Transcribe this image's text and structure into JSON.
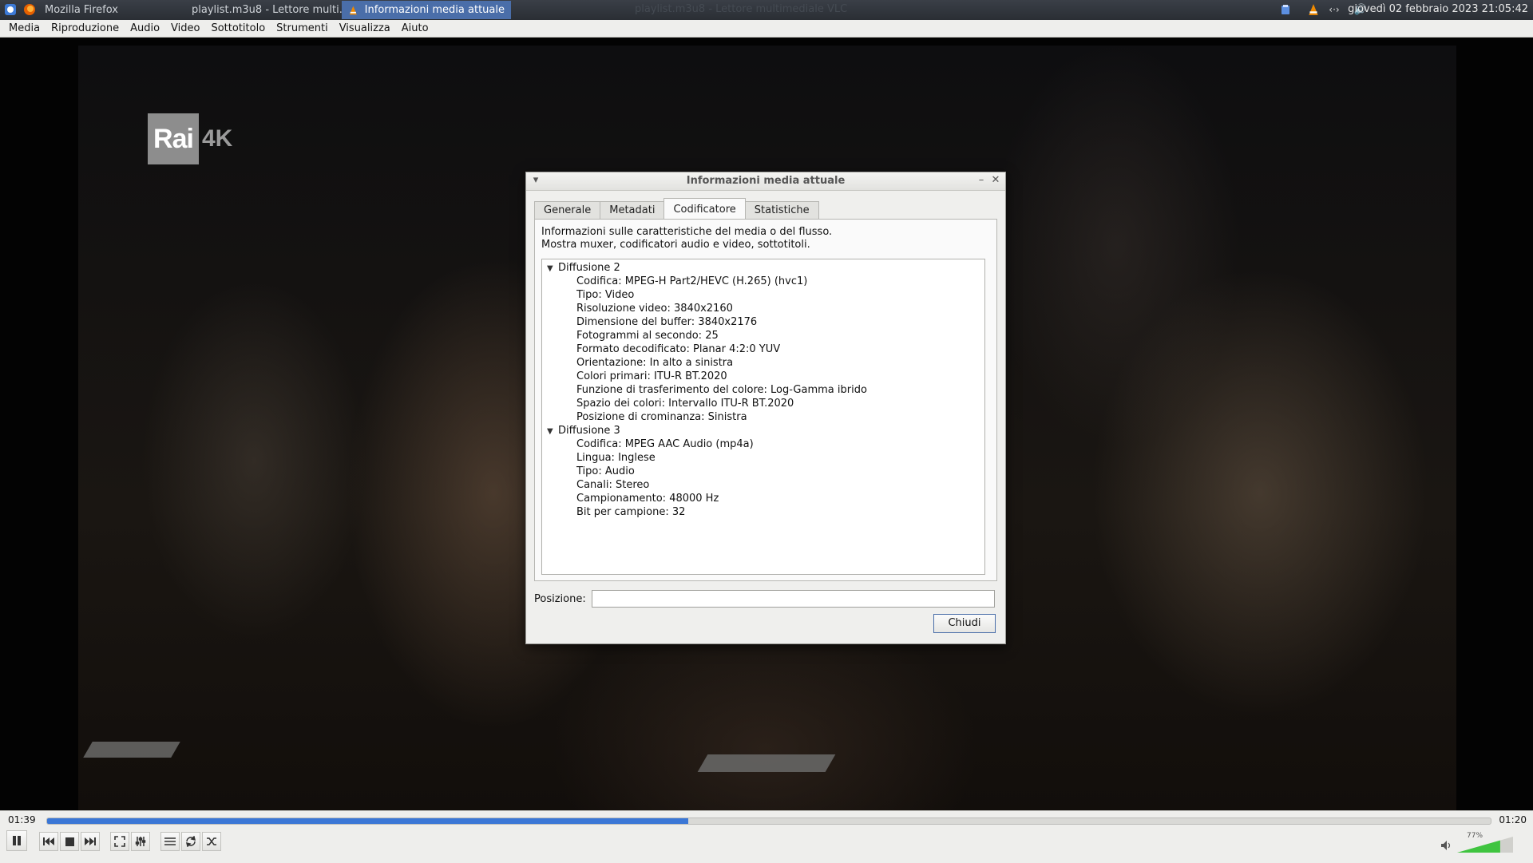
{
  "taskbar": {
    "tasks": [
      {
        "label": "Mozilla Firefox",
        "icon": "firefox-icon"
      },
      {
        "label": "playlist.m3u8 - Lettore multi...",
        "icon": "vlc-cone-icon"
      },
      {
        "label": "Informazioni media attuale",
        "icon": "vlc-cone-icon"
      }
    ],
    "faded_window_title": "playlist.m3u8 - Lettore multimediale VLC",
    "clock": "giovedì 02 febbraio 2023 21:05:42",
    "tray_icons": [
      "clipboard-icon",
      "vlc-cone-icon",
      "network-icon",
      "volume-icon"
    ]
  },
  "menubar": {
    "items": [
      "Media",
      "Riproduzione",
      "Audio",
      "Video",
      "Sottotitolo",
      "Strumenti",
      "Visualizza",
      "Aiuto"
    ]
  },
  "video": {
    "logo_text": "Rai",
    "logo_suffix": "4K"
  },
  "dialog": {
    "title": "Informazioni media attuale",
    "tabs": [
      "Generale",
      "Metadati",
      "Codificatore",
      "Statistiche"
    ],
    "active_tab": "Codificatore",
    "description_line1": "Informazioni sulle caratteristiche del media o del flusso.",
    "description_line2": "Mostra muxer, codificatori audio e video, sottotitoli.",
    "streams": [
      {
        "name": "Diffusione 2",
        "items": [
          "Codifica: MPEG-H Part2/HEVC (H.265) (hvc1)",
          "Tipo: Video",
          "Risoluzione video: 3840x2160",
          "Dimensione del buffer: 3840x2176",
          "Fotogrammi al secondo: 25",
          "Formato decodificato: Planar 4:2:0 YUV",
          "Orientazione: In alto a sinistra",
          "Colori primari: ITU-R BT.2020",
          "Funzione di trasferimento del colore: Log-Gamma ibrido",
          "Spazio dei colori: Intervallo ITU-R BT.2020",
          "Posizione di crominanza: Sinistra"
        ]
      },
      {
        "name": "Diffusione 3",
        "items": [
          "Codifica: MPEG AAC Audio (mp4a)",
          "Lingua: Inglese",
          "Tipo: Audio",
          "Canali: Stereo",
          "Campionamento: 48000 Hz",
          "Bit per campione: 32"
        ]
      }
    ],
    "position_label": "Posizione:",
    "position_value": "",
    "close_label": "Chiudi"
  },
  "player": {
    "elapsed": "01:39",
    "remaining": "01:20",
    "progress_fraction": 0.444,
    "volume_label": "77%",
    "volume_fraction": 0.77
  },
  "colors": {
    "accent": "#3b77d6",
    "active_task": "#4a6ea9",
    "chrome": "#eeeeec",
    "volume_green": "#3fc43f"
  }
}
